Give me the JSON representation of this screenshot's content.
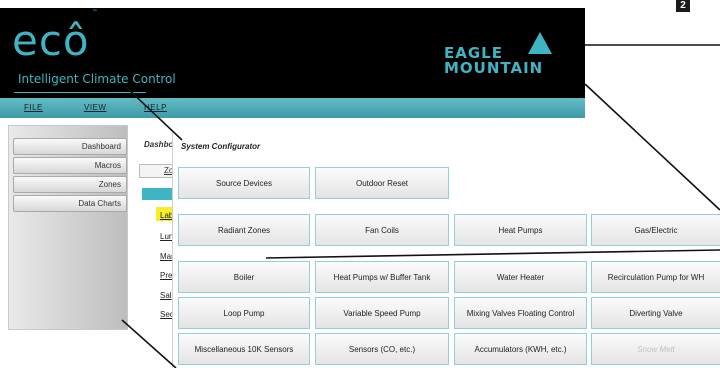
{
  "page_number": "2",
  "logo": {
    "wordmark": "ecô",
    "tm": "™",
    "tagline": "Intelligent Climate Control"
  },
  "brand": {
    "text": "EAGLE\nMOUNTAIN"
  },
  "menu": {
    "file": "FILE",
    "view": "VIEW",
    "help": "HELP"
  },
  "sidebar": {
    "items": [
      {
        "label": "Dashboard"
      },
      {
        "label": "Macros"
      },
      {
        "label": "Zones"
      },
      {
        "label": "Data Charts"
      }
    ]
  },
  "dashboard": {
    "title": "Dashboard",
    "tab": "Zo",
    "links": [
      {
        "label": "Lab"
      },
      {
        "label": "Lun"
      },
      {
        "label": "Mar"
      },
      {
        "label": "Pre"
      },
      {
        "label": "Sal"
      },
      {
        "label": "Sec"
      }
    ]
  },
  "configurator": {
    "title": "System Configurator",
    "buttons": {
      "source_devices": "Source Devices",
      "outdoor_reset": "Outdoor Reset",
      "radiant_zones": "Radiant Zones",
      "fan_coils": "Fan Coils",
      "heat_pumps": "Heat Pumps",
      "gas_electric": "Gas/Electric",
      "boiler": "Boiler",
      "heat_pumps_buffer": "Heat Pumps w/ Buffer Tank",
      "water_heater": "Water Heater",
      "recirculation_pump": "Recirculation Pump for WH",
      "loop_pump": "Loop Pump",
      "variable_speed_pump": "Variable Speed Pump",
      "mixing_valves": "Mixing Valves Floating Control",
      "diverting_valve": "Diverting Valve",
      "misc_sensors": "Miscellaneous 10K Sensors",
      "sensors_co": "Sensors (CO, etc.)",
      "accumulators": "Accumulators (KWH, etc.)",
      "snow_melt": "Snow Melt"
    }
  }
}
